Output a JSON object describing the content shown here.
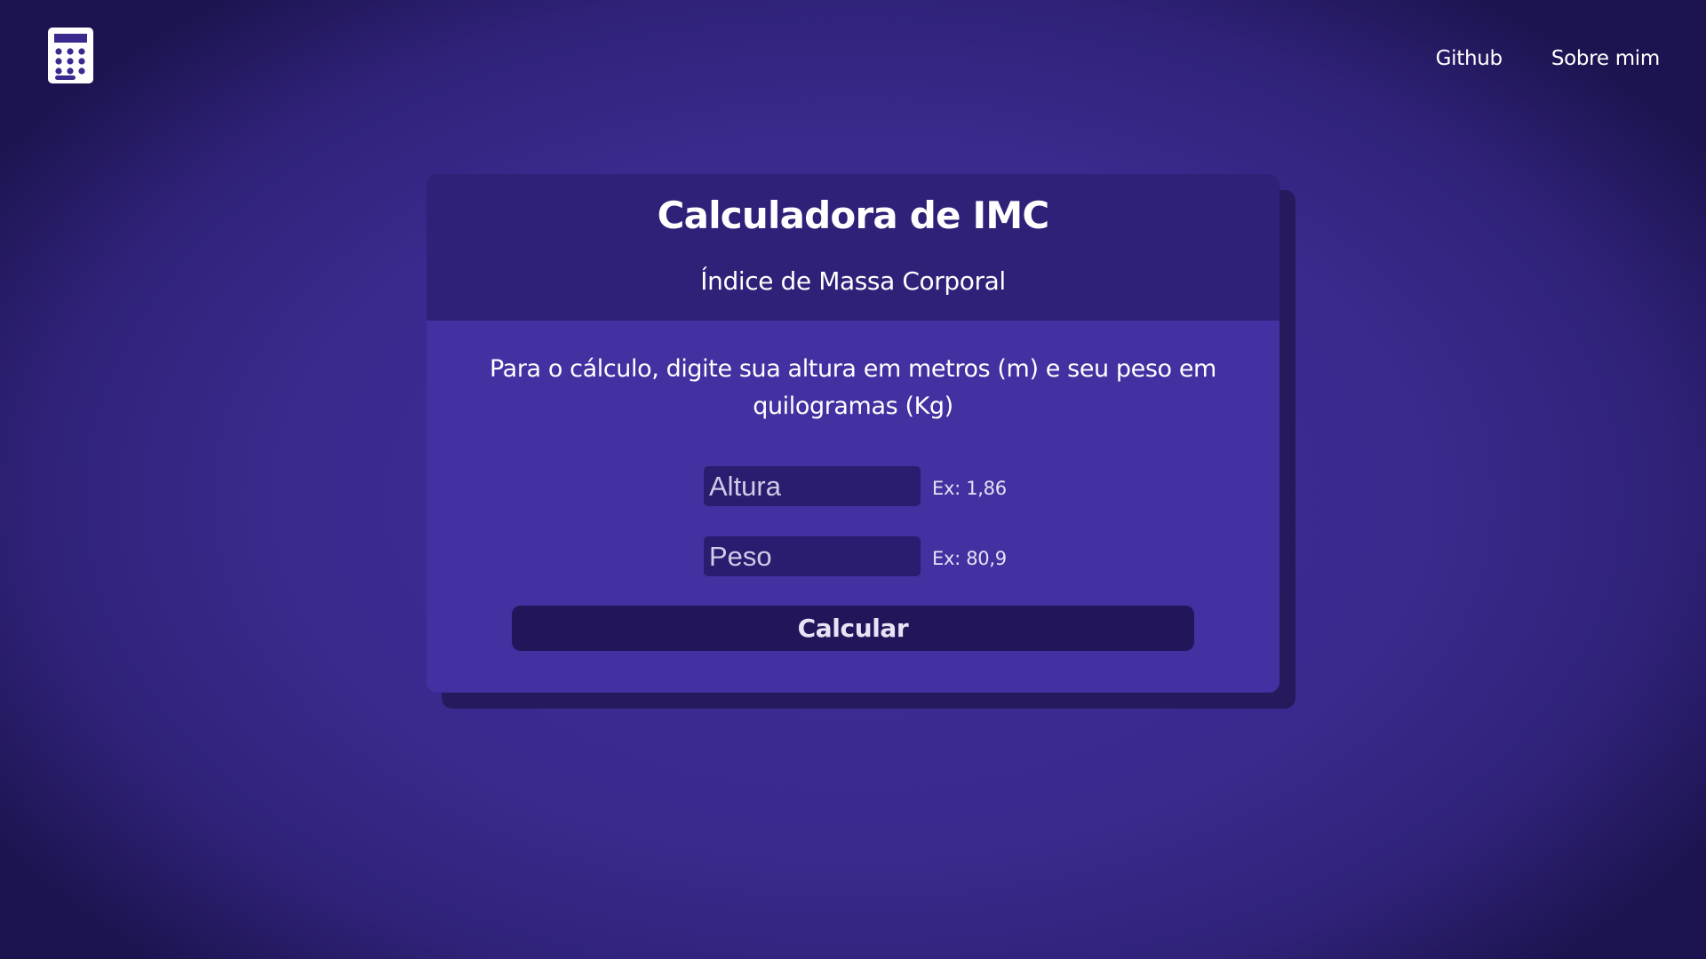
{
  "header": {
    "logo_icon": "calculator-icon",
    "nav": [
      {
        "label": "Github"
      },
      {
        "label": "Sobre mim"
      }
    ]
  },
  "card": {
    "title": "Calculadora de IMC",
    "subtitle": "Índice de Massa Corporal",
    "instructions": "Para o cálculo, digite sua altura em metros (m) e seu peso em quilogramas (Kg)",
    "fields": [
      {
        "placeholder": "Altura",
        "value": "",
        "hint": "Ex: 1,86"
      },
      {
        "placeholder": "Peso",
        "value": "",
        "hint": "Ex: 80,9"
      }
    ],
    "button_label": "Calcular"
  },
  "colors": {
    "background": "#3a2a8e",
    "card_header": "#2f2078",
    "card_body": "#4331a1",
    "input_bg": "#2a1d6f",
    "button_bg": "#22155a"
  }
}
